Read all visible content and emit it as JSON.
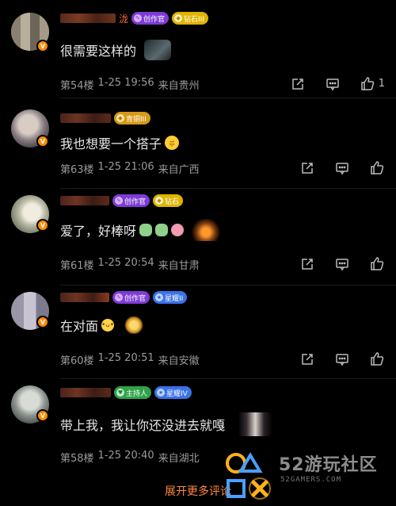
{
  "comments": [
    {
      "name_tail": "泷",
      "badges": [
        {
          "kind": "creator",
          "label": "创作官"
        },
        {
          "kind": "diamond",
          "label": "钻石III"
        }
      ],
      "text": "很需要这样的",
      "floor": "第54楼",
      "time": "1-25 19:56",
      "location": "来自贵州",
      "likes": "1"
    },
    {
      "name_tail": "",
      "badges": [
        {
          "kind": "bronze",
          "label": "青铜III"
        }
      ],
      "text": "我也想要一个搭子",
      "floor": "第63楼",
      "time": "1-25 21:06",
      "location": "来自广西",
      "likes": ""
    },
    {
      "name_tail": "",
      "badges": [
        {
          "kind": "creator",
          "label": "创作官"
        },
        {
          "kind": "diamond",
          "label": "钻石"
        }
      ],
      "text": "爱了，好棒呀",
      "floor": "第61楼",
      "time": "1-25 20:54",
      "location": "来自甘肃",
      "likes": ""
    },
    {
      "name_tail": "",
      "badges": [
        {
          "kind": "creator",
          "label": "创作官"
        },
        {
          "kind": "star",
          "label": "星耀II"
        }
      ],
      "text": "在对面",
      "floor": "第60楼",
      "time": "1-25 20:51",
      "location": "来自安徽",
      "likes": ""
    },
    {
      "name_tail": "",
      "badges": [
        {
          "kind": "host",
          "label": "主持人"
        },
        {
          "kind": "star",
          "label": "星耀IV"
        }
      ],
      "text": "带上我，我让你还没进去就嘎",
      "floor": "第58楼",
      "time": "1-25 20:40",
      "location": "来自湖北",
      "likes": ""
    }
  ],
  "footer": {
    "more_label": "展开更多评论"
  },
  "watermark": {
    "text": "52游玩社区",
    "sub": "52GAMERS.COM"
  },
  "icons": {
    "share": "share-icon",
    "reply": "reply-icon",
    "like": "thumbs-up-icon",
    "verified": "v-badge-icon"
  },
  "colors": {
    "accent": "#ff8a3a",
    "background": "#000000",
    "meta": "#9a9a9a"
  }
}
